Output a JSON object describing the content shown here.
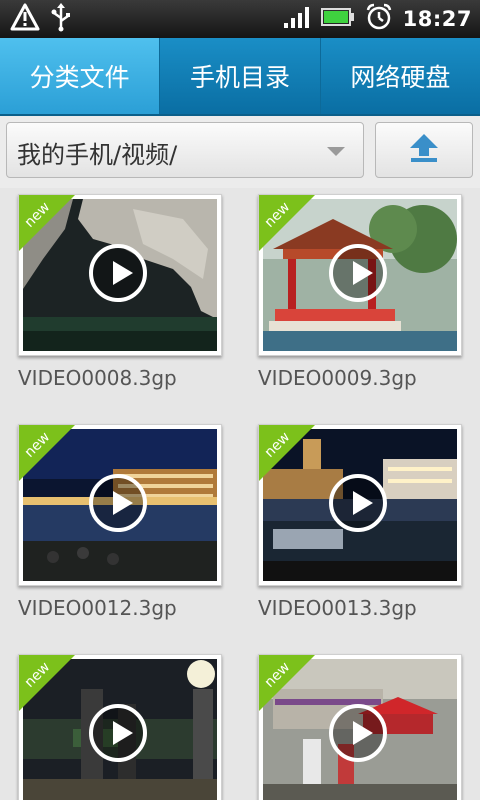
{
  "status_bar": {
    "time": "18:27",
    "icons": [
      "warning-icon",
      "usb-icon",
      "signal-icon",
      "battery-icon",
      "alarm-icon"
    ]
  },
  "tabs": [
    {
      "label": "分类文件",
      "active": true
    },
    {
      "label": "手机目录",
      "active": false
    },
    {
      "label": "网络硬盘",
      "active": false
    }
  ],
  "path": {
    "current": "我的手机/视频/",
    "up_icon": "up-arrow-icon"
  },
  "files": [
    {
      "name": "VIDEO0008.3gp",
      "badge": "new"
    },
    {
      "name": "VIDEO0009.3gp",
      "badge": "new"
    },
    {
      "name": "VIDEO0012.3gp",
      "badge": "new"
    },
    {
      "name": "VIDEO0013.3gp",
      "badge": "new"
    },
    {
      "name": "",
      "badge": "new"
    },
    {
      "name": "",
      "badge": "new"
    }
  ],
  "colors": {
    "tab_bar": "#1a8ec6",
    "tab_active": "#4fc0ee",
    "new_badge": "#7cc11b",
    "up_arrow": "#3a8fc9"
  }
}
